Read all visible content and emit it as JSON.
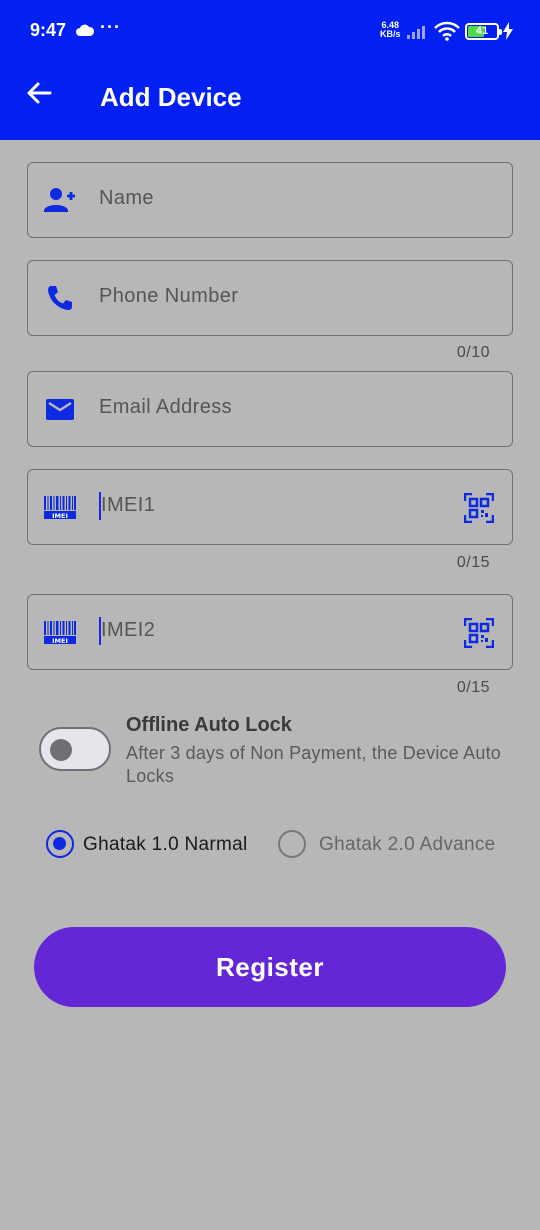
{
  "status_bar": {
    "time": "9:47",
    "more": "···",
    "speed_value": "6.48",
    "speed_unit": "KB/s",
    "battery": "41"
  },
  "app_bar": {
    "title": "Add Device"
  },
  "form": {
    "name": {
      "placeholder": "Name"
    },
    "phone": {
      "placeholder": "Phone Number",
      "counter": "0/10"
    },
    "email": {
      "placeholder": "Email Address"
    },
    "imei1": {
      "placeholder": "IMEI1",
      "counter": "0/15"
    },
    "imei2": {
      "placeholder": "IMEI2",
      "counter": "0/15"
    }
  },
  "offline_lock": {
    "title": "Offline Auto Lock",
    "description": "After 3 days of Non Payment, the Device Auto Locks",
    "enabled": false
  },
  "version_options": [
    {
      "label": "Ghatak 1.0 Narmal",
      "selected": true
    },
    {
      "label": "Ghatak 2.0 Advance",
      "selected": false
    }
  ],
  "register_label": "Register",
  "colors": {
    "primary": "#0320f2",
    "button": "#6427d6",
    "background": "#b7b7b7",
    "icon": "#0d2ae0"
  }
}
